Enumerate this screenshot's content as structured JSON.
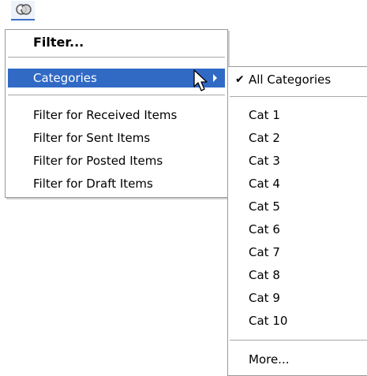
{
  "toolbar": {
    "filter_icon": "filter-icon"
  },
  "menu": {
    "filter_label": "Filter...",
    "categories_label": "Categories",
    "items": [
      {
        "label": "Filter for Received Items"
      },
      {
        "label": "Filter for Sent Items"
      },
      {
        "label": "Filter for Posted Items"
      },
      {
        "label": "Filter for Draft Items"
      }
    ]
  },
  "submenu": {
    "all_categories_label": "All Categories",
    "check_glyph": "✔",
    "categories": [
      {
        "label": "Cat 1"
      },
      {
        "label": "Cat 2"
      },
      {
        "label": "Cat 3"
      },
      {
        "label": "Cat 4"
      },
      {
        "label": "Cat 5"
      },
      {
        "label": "Cat 6"
      },
      {
        "label": "Cat 7"
      },
      {
        "label": "Cat 8"
      },
      {
        "label": "Cat 9"
      },
      {
        "label": "Cat 10"
      }
    ],
    "more_label": "More..."
  },
  "colors": {
    "highlight": "#316ac5",
    "highlight_text": "#ffffff",
    "border": "#9a9a9a"
  }
}
